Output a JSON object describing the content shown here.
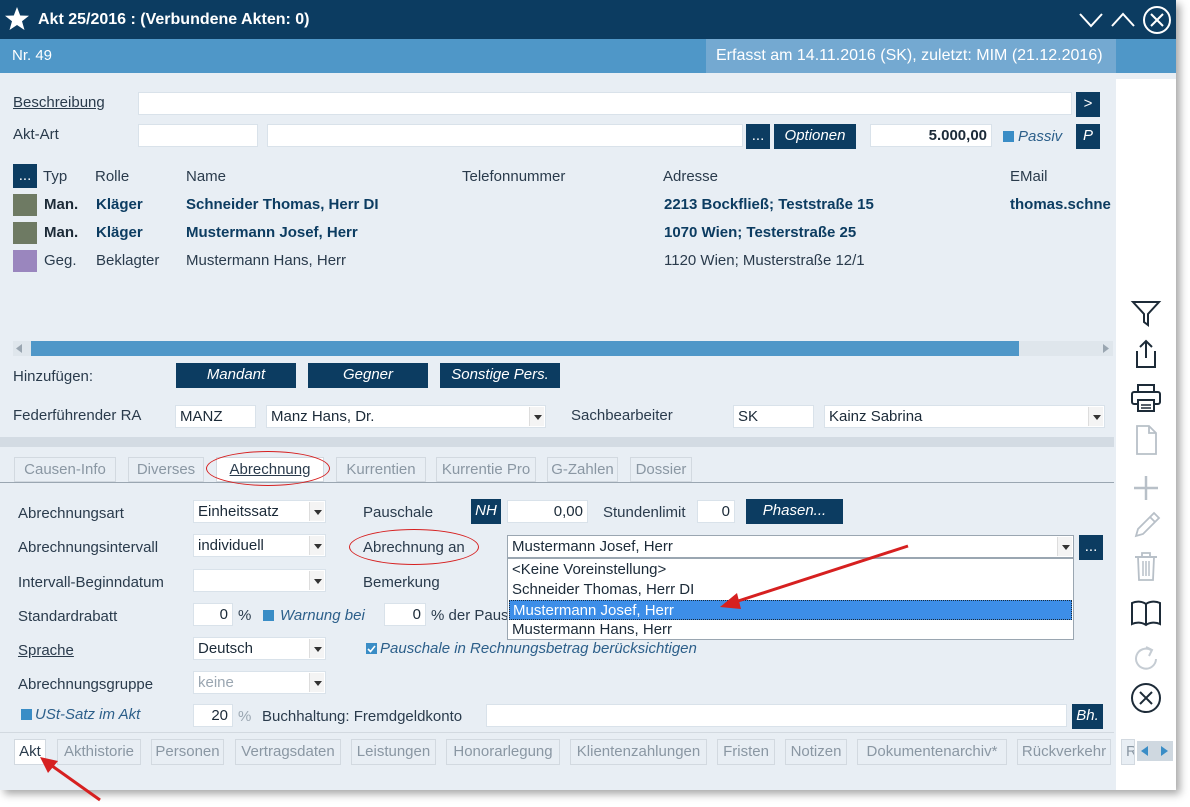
{
  "titlebar": {
    "title": "Akt 25/2016 :  (Verbundene Akten: 0)"
  },
  "subbar": {
    "nr": "Nr. 49",
    "erfasst": "Erfasst am 14.11.2016 (SK), zuletzt: MIM (21.12.2016)"
  },
  "form": {
    "beschreibung_label": "Beschreibung",
    "beschreibung_value": "",
    "aktart_label": "Akt-Art",
    "aktart_value": "",
    "aktart_value2": "",
    "more_btn": "...",
    "optionen_btn": "Optionen",
    "streitwert": "5.000,00",
    "passiv_label": "Passiv",
    "p_btn": "P",
    "arrow_btn": ">"
  },
  "parties": {
    "more_btn": "...",
    "headers": {
      "typ": "Typ",
      "rolle": "Rolle",
      "name": "Name",
      "telefon": "Telefonnummer",
      "adresse": "Adresse",
      "email": "EMail"
    },
    "rows": [
      {
        "typ": "Man.",
        "rolle": "Kläger",
        "name": "Schneider Thomas, Herr DI",
        "telefon": "",
        "adresse": "2213 Bockfließ; Teststraße 15",
        "email": "thomas.schne",
        "color": "#6e7a63",
        "bold": true
      },
      {
        "typ": "Man.",
        "rolle": "Kläger",
        "name": "Mustermann Josef, Herr",
        "telefon": "",
        "adresse": "1070 Wien; Testerstraße 25",
        "email": "",
        "color": "#6e7a63",
        "bold": true
      },
      {
        "typ": "Geg.",
        "rolle": "Beklagter",
        "name": "Mustermann Hans, Herr",
        "telefon": "",
        "adresse": "1120 Wien; Musterstraße 12/1",
        "email": "",
        "color": "#9a86be",
        "bold": false
      }
    ]
  },
  "add": {
    "label": "Hinzufügen:",
    "mandant": "Mandant",
    "gegner": "Gegner",
    "sonstige": "Sonstige Pers."
  },
  "ra": {
    "label": "Federführender RA",
    "code": "MANZ",
    "name": "Manz Hans, Dr.",
    "sb_label": "Sachbearbeiter",
    "sb_code": "SK",
    "sb_name": "Kainz Sabrina"
  },
  "tabs": [
    "Causen-Info",
    "Diverses",
    "Abrechnung",
    "Kurrentien",
    "Kurrentie Pro",
    "G-Zahlen",
    "Dossier"
  ],
  "abrechnung": {
    "art_label": "Abrechnungsart",
    "art_value": "Einheitssatz",
    "intervall_label": "Abrechnungsintervall",
    "intervall_value": "individuell",
    "beginn_label": "Intervall-Beginndatum",
    "beginn_value": "",
    "rabatt_label": "Standardrabatt",
    "rabatt_value": "0",
    "percent": "%",
    "warnung_label": "Warnung bei",
    "warnung_value": "0",
    "der_paus": "% der Paus",
    "sprache_label": "Sprache",
    "sprache_value": "Deutsch",
    "gruppe_label": "Abrechnungsgruppe",
    "gruppe_value": "keine",
    "ust_label": "USt-Satz im Akt",
    "ust_value": "20",
    "pauschale_label": "Pauschale",
    "nh_btn": "NH",
    "pauschale_value": "0,00",
    "stundenlimit_label": "Stundenlimit",
    "stundenlimit_value": "0",
    "phasen_btn": "Phasen...",
    "abrechnung_an_label": "Abrechnung an",
    "abrechnung_an_value": "Mustermann Josef, Herr",
    "more_btn": "...",
    "bemerkung_label": "Bemerkung",
    "pauschale_check": "Pauschale in Rechnungsbetrag berücksichtigen",
    "buchhaltung_label": "Buchhaltung: Fremdgeldkonto",
    "buchhaltung_value": "",
    "bh_btn": "Bh."
  },
  "dropdown": {
    "options": [
      "<Keine Voreinstellung>",
      "Schneider Thomas, Herr DI",
      "Mustermann Josef, Herr",
      "Mustermann Hans, Herr"
    ],
    "selected_index": 2
  },
  "bottom_tabs": [
    "Akt",
    "Akthistorie",
    "Personen",
    "Vertragsdaten",
    "Leistungen",
    "Honorarlegung",
    "Klientenzahlungen",
    "Fristen",
    "Notizen",
    "Dokumentenarchiv*",
    "Rückverkehr",
    "R"
  ],
  "colors": {
    "titlebar": "#0c3c61",
    "subbar": "#4f97c8",
    "accent": "#3a8dc6",
    "annotation": "#d62020"
  }
}
